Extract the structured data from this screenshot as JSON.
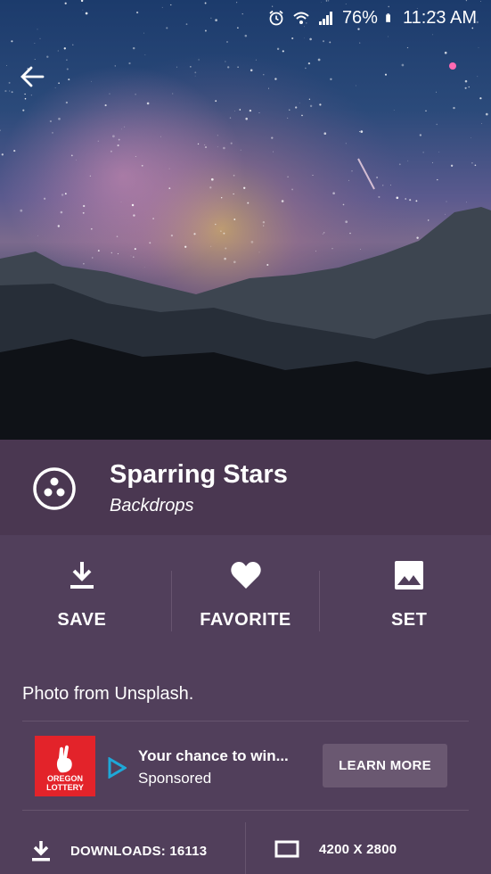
{
  "status_bar": {
    "battery": "76%",
    "time": "11:23 AM"
  },
  "wallpaper": {
    "title": "Sparring Stars",
    "category": "Backdrops",
    "credit": "Photo from Unsplash."
  },
  "actions": [
    {
      "label": "SAVE",
      "icon": "download-icon"
    },
    {
      "label": "FAVORITE",
      "icon": "heart-icon"
    },
    {
      "label": "SET",
      "icon": "image-icon"
    }
  ],
  "ad": {
    "brand": "OREGON LOTTERY",
    "title": "Your chance to win...",
    "sponsored": "Sponsored",
    "cta": "LEARN MORE"
  },
  "stats": {
    "downloads": "DOWNLOADS: 16113",
    "resolution": "4200 X 2800"
  },
  "colors": {
    "panel": "#513f5b",
    "title_bar": "#4a3751",
    "ad_red": "#e3232a",
    "play_blue": "#1ea8d8"
  }
}
